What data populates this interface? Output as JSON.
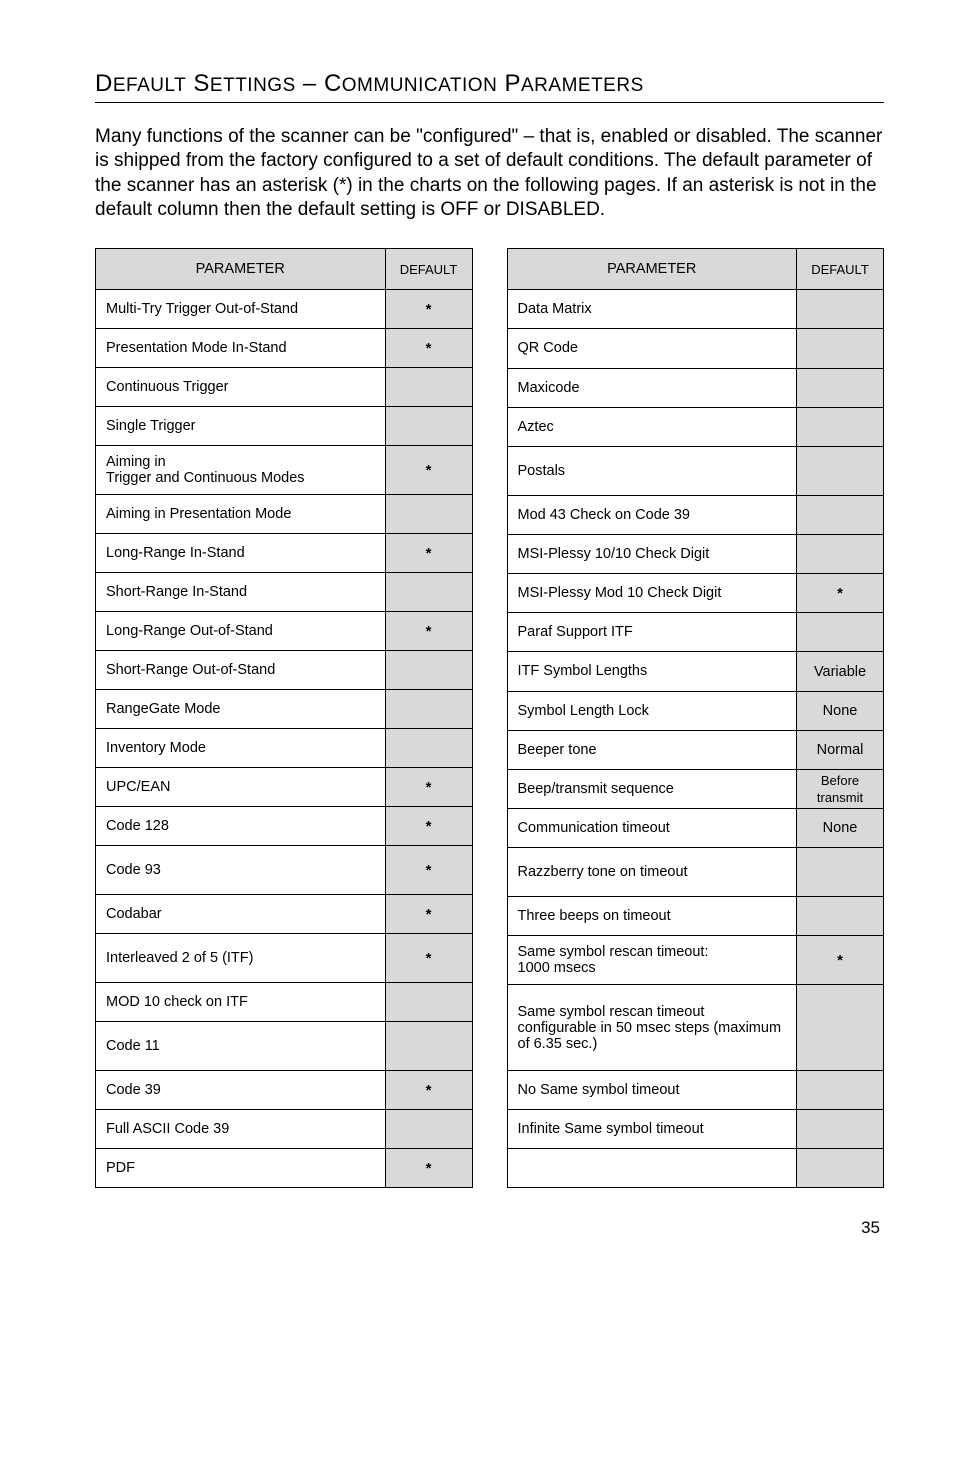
{
  "title_parts": [
    "D",
    "EFAULT",
    " S",
    "ETTINGS",
    " – C",
    "OMMUNICATION",
    " P",
    "ARAMETERS"
  ],
  "intro": "Many functions of the scanner can be \"configured\" – that is, enabled or disabled. The scanner is shipped from the factory configured to a set of default conditions. The default parameter of the scanner has an asterisk (*) in the charts on the following pages.  If an asterisk is not in the default column then the default setting is OFF or DISABLED.",
  "header_param": "PARAMETER",
  "header_default": "DEFAULT",
  "left_rows": [
    {
      "label": "Multi-Try Trigger Out-of-Stand",
      "val": "*",
      "shaded": true
    },
    {
      "label": "Presentation Mode In-Stand",
      "val": "*",
      "shaded": true
    },
    {
      "label": "Continuous Trigger",
      "val": "",
      "shaded": true
    },
    {
      "label": "Single Trigger",
      "val": "",
      "shaded": true
    },
    {
      "label": "Aiming in\nTrigger and Continuous Modes",
      "val": "*",
      "shaded": true,
      "tall": true
    },
    {
      "label": "Aiming in Presentation Mode",
      "val": "",
      "shaded": true
    },
    {
      "label": "Long-Range In-Stand",
      "val": "*",
      "shaded": true
    },
    {
      "label": "Short-Range In-Stand",
      "val": "",
      "shaded": true
    },
    {
      "label": "Long-Range Out-of-Stand",
      "val": "*",
      "shaded": true
    },
    {
      "label": "Short-Range Out-of-Stand",
      "val": "",
      "shaded": true
    },
    {
      "label": "RangeGate Mode",
      "val": "",
      "shaded": true
    },
    {
      "label": "Inventory Mode",
      "val": "",
      "shaded": true
    },
    {
      "label": "UPC/EAN",
      "val": "*",
      "shaded": true
    },
    {
      "label": "Code 128",
      "val": "*",
      "shaded": true
    },
    {
      "label": "Code 93",
      "val": "*",
      "shaded": true,
      "tall": true
    },
    {
      "label": "Codabar",
      "val": "*",
      "shaded": true
    },
    {
      "label": "Interleaved 2 of 5 (ITF)",
      "val": "*",
      "shaded": true,
      "tall": true
    },
    {
      "label": "MOD 10 check on ITF",
      "val": "",
      "shaded": true
    },
    {
      "label": "Code 11",
      "val": "",
      "shaded": true,
      "tall": true
    },
    {
      "label": "Code 39",
      "val": "*",
      "shaded": true
    },
    {
      "label": "Full ASCII Code 39",
      "val": "",
      "shaded": true
    },
    {
      "label": "PDF",
      "val": "*",
      "shaded": true
    }
  ],
  "right_rows": [
    {
      "label": "Data Matrix",
      "val": "",
      "shaded": true
    },
    {
      "label": "QR Code",
      "val": "",
      "shaded": true
    },
    {
      "label": "Maxicode",
      "val": "",
      "shaded": true
    },
    {
      "label": "Aztec",
      "val": "",
      "shaded": true
    },
    {
      "label": "Postals",
      "val": "",
      "shaded": true,
      "tall": true
    },
    {
      "label": "Mod 43 Check on Code 39",
      "val": "",
      "shaded": true
    },
    {
      "label": "MSI-Plessy 10/10 Check Digit",
      "val": "",
      "shaded": true
    },
    {
      "label": "MSI-Plessy Mod 10 Check Digit",
      "val": "*",
      "shaded": true
    },
    {
      "label": "Paraf Support ITF",
      "val": "",
      "shaded": true
    },
    {
      "label": "ITF Symbol Lengths",
      "val": "Variable",
      "shaded": true,
      "nondef": true
    },
    {
      "label": "Symbol Length Lock",
      "val": "None",
      "shaded": true,
      "nondef": true
    },
    {
      "label": "Beeper tone",
      "val": "Normal",
      "shaded": true,
      "nondef": true
    },
    {
      "label": "Beep/transmit sequence",
      "val": "Before transmit",
      "shaded": true,
      "nondef": true,
      "small": true
    },
    {
      "label": "Communication timeout",
      "val": "None",
      "shaded": true,
      "nondef": true
    },
    {
      "label": "Razzberry tone on timeout",
      "val": "",
      "shaded": true,
      "tall": true
    },
    {
      "label": "Three beeps on timeout",
      "val": "",
      "shaded": true
    },
    {
      "label": "Same symbol rescan timeout:\n1000 msecs",
      "val": "*",
      "shaded": true,
      "tall": true
    },
    {
      "label": "Same symbol rescan timeout configurable in 50 msec steps (maximum of 6.35 sec.)",
      "val": "",
      "shaded": true,
      "merge_height": 2
    },
    {
      "label": "No Same symbol timeout",
      "val": "",
      "shaded": true
    },
    {
      "label": "Infinite Same symbol timeout",
      "val": "",
      "shaded": true
    },
    {
      "label": "",
      "val": "",
      "shaded": true
    }
  ],
  "page_number": "35"
}
